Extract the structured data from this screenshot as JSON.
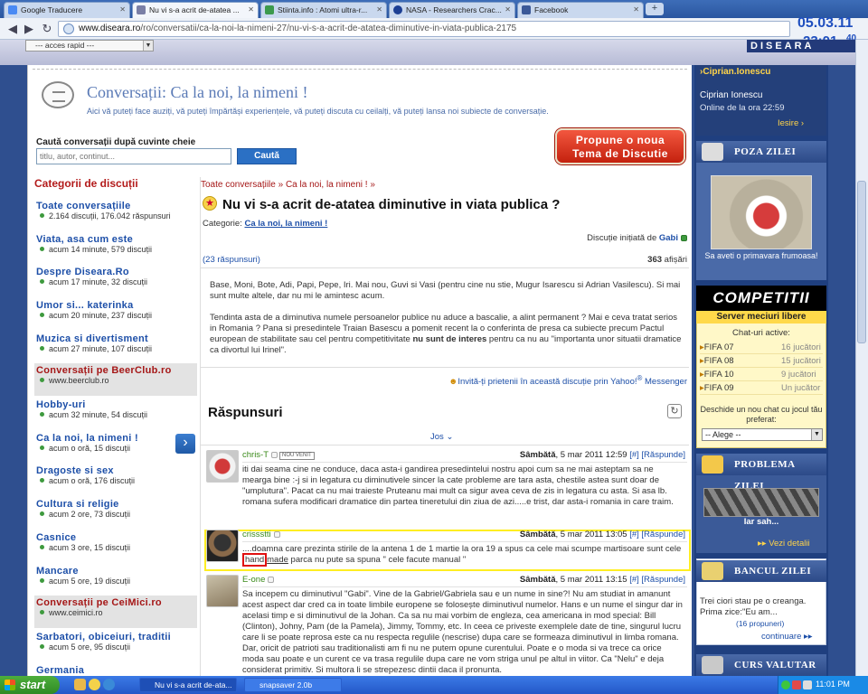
{
  "browser": {
    "tabs": [
      {
        "label": "Google Traducere",
        "active": false
      },
      {
        "label": "Nu vi s-a acrit de-atatea ...",
        "active": true
      },
      {
        "label": "Stiinta.info : Atomi ultra-r...",
        "active": false
      },
      {
        "label": "NASA - Researchers Crac...",
        "active": false
      },
      {
        "label": "Facebook",
        "active": false
      }
    ],
    "new_tab": "+",
    "url_domain": "www.diseara.ro",
    "url_path": "/ro/conversatii/ca-la-noi-la-nimeni-27/nu-vi-s-a-acrit-de-atatea-diminutive-in-viata-publica-2175",
    "clock_date": "05.03.11",
    "clock_time": "23:01",
    "clock_seconds": "40"
  },
  "site": {
    "acces_rapid": "--- acces rapid ---",
    "logo": "DISEARA"
  },
  "header": {
    "title": "Conversații:  Ca la noi, la nimeni !",
    "subtitle": "Aici vă puteți face auziți, vă puteți împărtăși experiențele, vă puteți discuta cu ceilalți, vă puteți lansa noi subiecte de conversație.",
    "search_label": "Caută conversații după cuvinte cheie",
    "search_placeholder": "titlu, autor, continut...",
    "search_button": "Caută",
    "propose_line1": "Propune o noua",
    "propose_line2": "Tema de Discutie"
  },
  "sidebar": {
    "heading": "Categorii de discuții",
    "items": [
      {
        "title": "Toate conversațiile",
        "sub": "2.164 discuții, 176.042 răspunsuri"
      },
      {
        "title": "Viata, asa cum este",
        "sub": "acum 14 minute, 579 discuții"
      },
      {
        "title": "Despre Diseara.Ro",
        "sub": "acum 17 minute, 32 discuții"
      },
      {
        "title": "Umor si... katerinka",
        "sub": "acum 20 minute, 237 discuții"
      },
      {
        "title": "Muzica si divertisment",
        "sub": "acum 27 minute, 107 discuții"
      },
      {
        "title": "Conversații pe BeerClub.ro",
        "sub": "www.beerclub.ro"
      },
      {
        "title": "Hobby-uri",
        "sub": "acum 32 minute, 54 discuții"
      },
      {
        "title": "Ca la noi, la nimeni !",
        "sub": "acum o oră, 15 discuții"
      },
      {
        "title": "Dragoste si sex",
        "sub": "acum o oră, 176 discuții"
      },
      {
        "title": "Cultura si religie",
        "sub": "acum 2 ore, 73 discuții"
      },
      {
        "title": "Casnice",
        "sub": "acum 3 ore, 15 discuții"
      },
      {
        "title": "Mancare",
        "sub": "acum 5 ore, 19 discuții"
      },
      {
        "title": "Conversații pe CeiMici.ro",
        "sub": "www.ceimici.ro"
      },
      {
        "title": "Sarbatori, obiceiuri, traditii",
        "sub": "acum 5 ore, 95 discuții"
      },
      {
        "title": "Germania",
        "sub": ""
      }
    ]
  },
  "topic": {
    "breadcrumb_root": "Toate conversațiile",
    "breadcrumb_sep": " » ",
    "breadcrumb_cat": "Ca la noi, la nimeni !",
    "breadcrumb_end": " »",
    "title": "Nu vi s-a acrit de-atatea diminutive in viata publica ?",
    "category_label": "Categorie: ",
    "category": "Ca la noi, la nimeni !",
    "initiated_label": "Discuție inițiată de ",
    "initiator": "Gabi",
    "replies": "(23 răspunsuri)",
    "views_count": "363",
    "views_label": " afișări",
    "intro_p1": "Base, Moni, Bote, Adi, Papi, Pepe, Iri. Mai nou, Guvi si Vasi (pentru cine nu stie, Mugur Isarescu si Adrian Vasilescu). Si mai sunt multe altele, dar nu mi le amintesc acum.",
    "intro_p2a": "Tendinta asta de a diminutiva numele persoanelor publice nu aduce a bascalie, a alint permanent ? Mai e ceva tratat serios in Romania ? Pana si presedintele Traian Basescu a pomenit recent la o conferinta de presa ca subiecte precum Pactul european de stabilitate sau cel pentru competitivitate ",
    "intro_p2b": "nu sunt de interes",
    "intro_p2c": " pentru ca nu au \"importanta unor situatii dramatice ca divortul lui Irinel\".",
    "invite": "Invită-ți prietenii în această discuție prin Yahoo!",
    "invite_reg": "®",
    "invite_app": " Messenger"
  },
  "responses": {
    "heading": "Răspunsuri",
    "jos": "Jos",
    "posts": [
      {
        "author": "chris-T",
        "badge": "NOU VENIT",
        "date": "Sâmbătă",
        "time": ", 5 mar 2011 12:59",
        "hash": "[#]",
        "reply": "[Răspunde]",
        "body": "iti dai seama cine ne conduce, daca asta-i gandirea presedintelui nostru apoi cum sa ne mai asteptam sa ne mearga bine :-j si in legatura cu diminutivele sincer la cate probleme are tara asta, chestile astea sunt doar de \"umplutura\". Pacat ca nu mai traieste Pruteanu mai mult ca sigur avea ceva de zis in legatura cu asta. Si asa lb. romana sufera modificari dramatice din partea tineretului din ziua de azi.....e trist, dar asta-i romania in care traim."
      },
      {
        "author": "crissstti",
        "date": "Sâmbătă",
        "time": ", 5 mar 2011 13:05",
        "hash": "[#]",
        "reply": "[Răspunde]",
        "body_a": "....doamna care prezinta stirile de la antena 1 de 1 martie la ora 19 a spus ca cele mai scumpe martisoare sunt cele ",
        "body_hl": "hand",
        "body_b": "made",
        "body_c": " parca nu pute sa spuna  \" cele facute manual \""
      },
      {
        "author": "E-one",
        "date": "Sâmbătă",
        "time": ", 5 mar 2011 13:15",
        "hash": "[#]",
        "reply": "[Răspunde]",
        "body": "Sa incepem cu diminutivul \"Gabi\". Vine de la Gabriel/Gabriela sau e un nume in sine?! Nu am studiat in amanunt acest aspect dar cred ca in toate limbile europene se folosește diminutivul numelor. Hans e un nume el singur dar in acelasi timp e si diminutivul de la Johan. Ca sa nu mai vorbim de engleza, cea americana in mod special: Bill (Clinton), Johny, Pam (de la Pamela), Jimmy, Tommy, etc. In ceea ce priveste exemplele date de tine, singurul lucru care li se poate reprosa este ca nu respecta regulile (nescrise) dupa care se formeaza diminutivul in limba romana. Dar, oricit de patrioti sau traditionalisti am fi nu ne putem opune curentului. Poate e o moda si va trece ca orice moda sau poate e un curent ce va trasa regulile dupa care ne vom striga unul pe altul in viitor. Ca \"Nelu\" e deja considerat primitiv. Si multora li se strepezesc dintii daca il pronunta."
      }
    ]
  },
  "right": {
    "user_link": "Ciprian.Ionescu",
    "user_name": "Ciprian Ionescu",
    "user_online": "Online de la ora 22:59",
    "logout": "Iesire",
    "poza_title": "POZA ZILEI",
    "poza_caption": "Sa aveti o primavara frumoasa!",
    "comp_title": "COMPETITII",
    "comp_sub": "Server meciuri libere",
    "chat_label": "Chat-uri active:",
    "games": [
      {
        "name": "FIFA 07",
        "players": "16 jucători"
      },
      {
        "name": "FIFA 08",
        "players": "15 jucători"
      },
      {
        "name": "FIFA 10",
        "players": "9 jucători"
      },
      {
        "name": "FIFA 09",
        "players": "Un jucător"
      }
    ],
    "chat_desc": "Deschide un nou chat cu jocul tău preferat:",
    "alege": "-- Alege --",
    "problema_title": "PROBLEMA ZILEI",
    "problema_text": "Iar sah...",
    "problema_link": "Vezi detalii",
    "banc_title": "BANCUL ZILEI",
    "banc_text": "Trei ciori stau pe o creanga. Prima zice:\"Eu am...",
    "banc_count": "(16 propuneri)",
    "banc_more": "continuare",
    "curs_title": "CURS VALUTAR"
  },
  "taskbar": {
    "start": "start",
    "tasks": [
      {
        "label": "Nu vi s-a acrit de-ata...",
        "active": true
      },
      {
        "label": "snapsaver 2.0b",
        "active": false
      }
    ],
    "time": "11:01 PM"
  },
  "colors": {
    "accent_blue": "#1d4fa8",
    "category_red": "#a51717",
    "highlight_yellow": "#ffee22",
    "highlight_red": "#e01010"
  }
}
